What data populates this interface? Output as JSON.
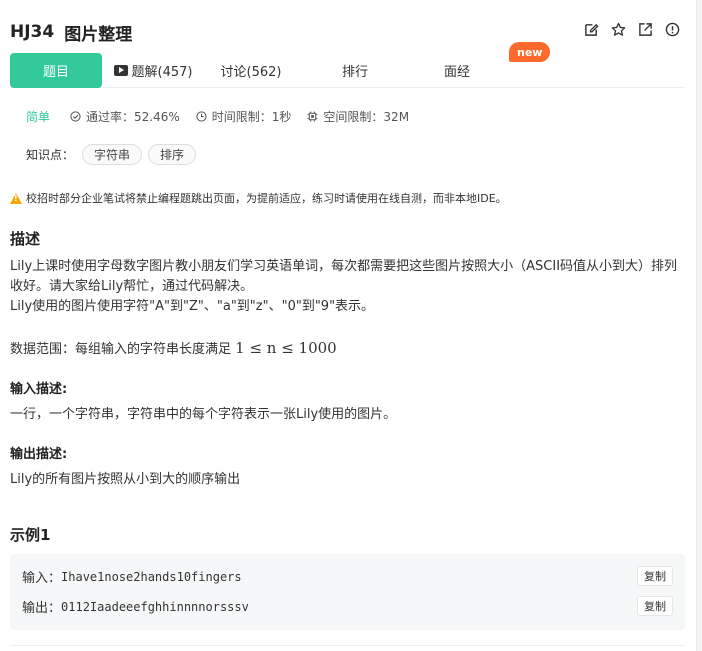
{
  "header": {
    "id": "HJ34",
    "title": "图片整理",
    "icons": [
      "edit-icon",
      "star-icon",
      "external-link-icon",
      "info-icon"
    ]
  },
  "tabs": [
    {
      "label": "题目",
      "active": true
    },
    {
      "label": "题解(457)",
      "icon": "video-icon"
    },
    {
      "label": "讨论(562)"
    },
    {
      "label": "排行"
    },
    {
      "label": "面经"
    }
  ],
  "new_badge": "new",
  "meta": {
    "difficulty": "简单",
    "pass_rate": "通过率：52.46%",
    "time_limit": "时间限制：1秒",
    "space_limit": "空间限制：32M"
  },
  "knowledge": {
    "label": "知识点：",
    "tags": [
      "字符串",
      "排序"
    ]
  },
  "warning": "校招时部分企业笔试将禁止编程题跳出页面，为提前适应，练习时请使用在线自测，而非本地IDE。",
  "description": {
    "title": "描述",
    "line1": "Lily上课时使用字母数字图片教小朋友们学习英语单词，每次都需要把这些图片按照大小（ASCII码值从小到大）排列收好。请大家给Lily帮忙，通过代码解决。",
    "line2": "Lily使用的图片使用字符\"A\"到\"Z\"、\"a\"到\"z\"、\"0\"到\"9\"表示。",
    "range_prefix": "数据范围：每组输入的字符串长度满足 ",
    "range_math": "1 ≤ n ≤ 1000"
  },
  "input_desc": {
    "title": "输入描述:",
    "text": "一行，一个字符串，字符串中的每个字符表示一张Lily使用的图片。"
  },
  "output_desc": {
    "title": "输出描述:",
    "text": "Lily的所有图片按照从小到大的顺序输出"
  },
  "example": {
    "title": "示例1",
    "input_label": "输入：",
    "input_value": "Ihave1nose2hands10fingers",
    "output_label": "输出：",
    "output_value": "0112Iaadeeefghhinnnnorsssv",
    "copy_label": "复制"
  }
}
